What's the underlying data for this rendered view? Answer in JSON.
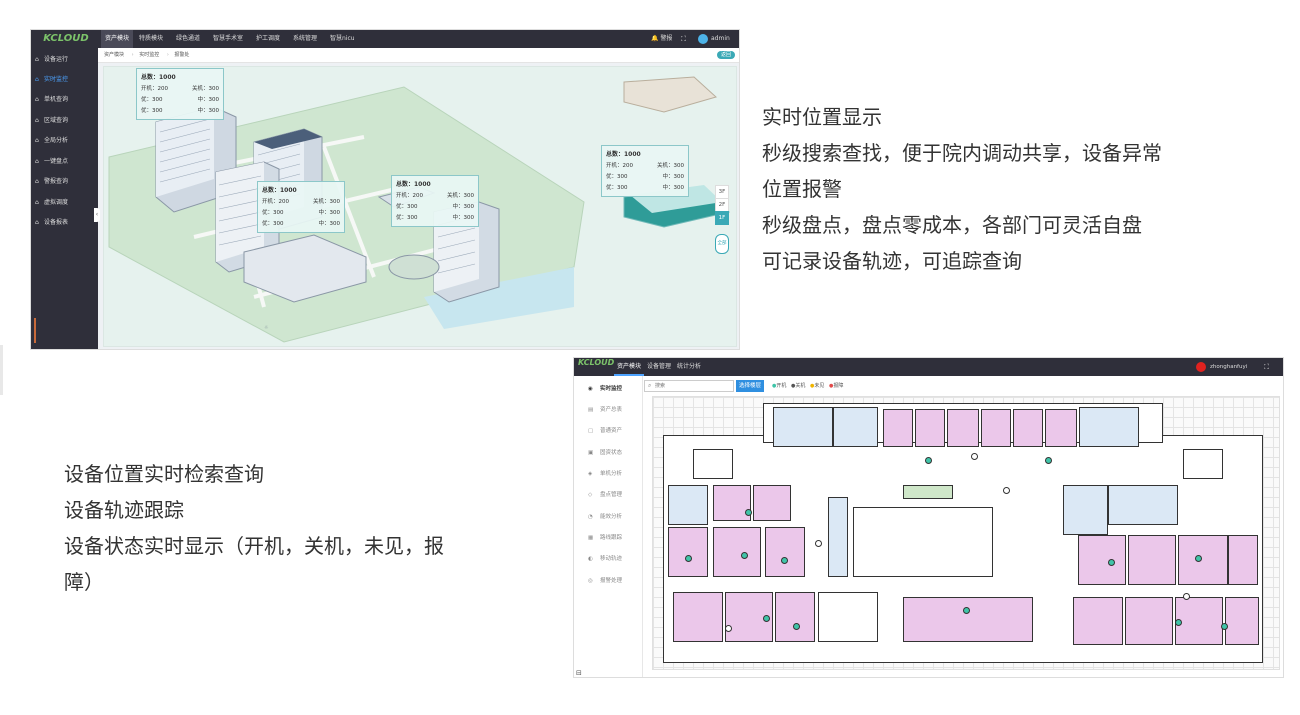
{
  "panel1": {
    "logo": "KCLOUD",
    "nav": [
      "资产模块",
      "特质模块",
      "绿色通道",
      "智慧手术室",
      "护工调度",
      "系统管理",
      "智慧nicu"
    ],
    "header_right": {
      "alarm": "警报",
      "user": "admin"
    },
    "sidebar": [
      "设备运行",
      "实时监控",
      "单机查询",
      "区域查询",
      "全局分析",
      "一键盘点",
      "警报查询",
      "虚拟调度",
      "设备报表"
    ],
    "breadcrumb": [
      "资产模块",
      "实时监控",
      "报警处"
    ],
    "return_label": "返回",
    "cards": [
      {
        "total": "总数：1000",
        "kaiji": "开机：200",
        "guanji": "关机：300",
        "you": "优：300",
        "zhong": "中：300",
        "cha": "优：300",
        "dii": "中：300"
      },
      {
        "total": "总数：1000",
        "kaiji": "开机：200",
        "guanji": "关机：300",
        "you": "优：300",
        "zhong": "中：300",
        "cha": "优：300",
        "dii": "中：300"
      },
      {
        "total": "总数：1000",
        "kaiji": "开机：200",
        "guanji": "关机：300",
        "you": "优：300",
        "zhong": "中：300",
        "cha": "优：300",
        "dii": "中：300"
      },
      {
        "total": "总数：1000",
        "kaiji": "开机：200",
        "guanji": "关机：300",
        "you": "优：300",
        "zhong": "中：300",
        "cha": "优：300",
        "dii": "中：300"
      }
    ],
    "floors": [
      "3F",
      "2F",
      "1F"
    ],
    "side_btn": "全部"
  },
  "text_right": [
    "实时位置显示",
    "秒级搜索查找，便于院内调动共享，设备异常",
    "位置报警",
    "秒级盘点，盘点零成本，各部门可灵活自盘",
    "可记录设备轨迹，可追踪查询"
  ],
  "text_left": [
    "设备位置实时检索查询",
    "设备轨迹跟踪",
    "设备状态实时显示（开机，关机，未见，报",
    "障）"
  ],
  "panel2": {
    "logo": "KCLOUD",
    "nav": [
      "资产模块",
      "设备管理",
      "统计分析"
    ],
    "user": "zhonghanfuyi",
    "sidebar": [
      "实时监控",
      "资产总表",
      "普通资产",
      "固资状态",
      "单机分析",
      "盘点管理",
      "能效分析",
      "路线跟踪",
      "移动轨迹",
      "报警处理"
    ],
    "search_placeholder": "搜索",
    "select_floor": "选择楼层",
    "legend": [
      "开机",
      "关机",
      "未见",
      "报障"
    ],
    "legend_colors": [
      "#3fc4a8",
      "#555555",
      "#f0b400",
      "#e24b4b"
    ]
  }
}
